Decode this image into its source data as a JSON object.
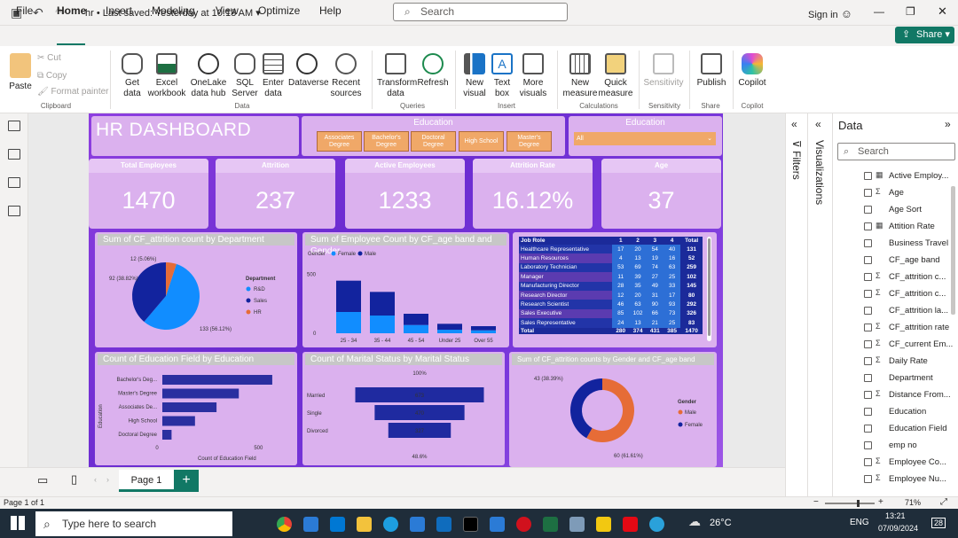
{
  "titlebar": {
    "doc_title": "hr • Last saved: Yesterday at 10:18 AM",
    "search_placeholder": "Search",
    "signin": "Sign in"
  },
  "menu": [
    "File",
    "Home",
    "Insert",
    "Modeling",
    "View",
    "Optimize",
    "Help"
  ],
  "share_label": "Share",
  "ribbon": {
    "paste": "Paste",
    "cut": "Cut",
    "copy": "Copy",
    "format_painter": "Format painter",
    "get_data": "Get data",
    "excel": "Excel workbook",
    "onelake": "OneLake data hub",
    "sql": "SQL Server",
    "enter": "Enter data",
    "dataverse": "Dataverse",
    "recent": "Recent sources",
    "transform": "Transform data",
    "refresh": "Refresh",
    "new_visual": "New visual",
    "text_box": "Text box",
    "more_visuals": "More visuals",
    "new_measure": "New measure",
    "quick_measure": "Quick measure",
    "sensitivity": "Sensitivity",
    "publish": "Publish",
    "copilot": "Copilot",
    "groups": {
      "clipboard": "Clipboard",
      "data": "Data",
      "queries": "Queries",
      "insert": "Insert",
      "calculations": "Calculations",
      "sensitivity": "Sensitivity",
      "share": "Share",
      "copilot": "Copilot"
    }
  },
  "dashboard": {
    "title": "HR DASHBOARD",
    "education_slicer": {
      "title": "Education",
      "options": [
        "Associates Degree",
        "Bachelor's Degree",
        "Doctoral Degree",
        "High School",
        "Master's Degree"
      ]
    },
    "education_dropdown": {
      "title": "Education",
      "value": "All"
    },
    "kpis": [
      {
        "label": "Total Employees",
        "value": "1470"
      },
      {
        "label": "Attrition",
        "value": "237"
      },
      {
        "label": "Active Employees",
        "value": "1233"
      },
      {
        "label": "Attrition Rate",
        "value": "16.12%"
      },
      {
        "label": "Age",
        "value": "37"
      }
    ]
  },
  "chart_data": [
    {
      "type": "pie",
      "title": "Sum of CF_attrition count by Department",
      "legend_title": "Department",
      "labels": [
        "R&D",
        "Sales",
        "HR"
      ],
      "values": [
        133,
        92,
        12
      ],
      "data_labels": [
        "133 (56.12%)",
        "92 (38.82%)",
        "12 (5.06%)"
      ],
      "colors": [
        "#118dff",
        "#12239e",
        "#e66c37"
      ]
    },
    {
      "type": "bar",
      "title": "Sum of Employee Count by CF_age band and Gender",
      "legend_title": "Gender",
      "series_names": [
        "Female",
        "Male"
      ],
      "categories": [
        "25 - 34",
        "35 - 44",
        "45 - 54",
        "Under 25",
        "Over 55"
      ],
      "series": [
        {
          "name": "Female",
          "values": [
            180,
            150,
            70,
            30,
            25
          ]
        },
        {
          "name": "Male",
          "values": [
            265,
            200,
            95,
            50,
            35
          ]
        }
      ],
      "ytick": "500",
      "ymax": 600,
      "colors": [
        "#118dff",
        "#12239e"
      ]
    },
    {
      "type": "table",
      "title": "",
      "columns": [
        "Job Role",
        "1",
        "2",
        "3",
        "4",
        "Total"
      ],
      "rows": [
        [
          "Healthcare Representative",
          "17",
          "20",
          "54",
          "40",
          "131"
        ],
        [
          "Human Resources",
          "4",
          "13",
          "19",
          "16",
          "52"
        ],
        [
          "Laboratory Technician",
          "53",
          "69",
          "74",
          "63",
          "259"
        ],
        [
          "Manager",
          "11",
          "39",
          "27",
          "25",
          "102"
        ],
        [
          "Manufacturing Director",
          "28",
          "35",
          "49",
          "33",
          "145"
        ],
        [
          "Research Director",
          "12",
          "20",
          "31",
          "17",
          "80"
        ],
        [
          "Research Scientist",
          "46",
          "63",
          "90",
          "93",
          "292"
        ],
        [
          "Sales Executive",
          "85",
          "102",
          "66",
          "73",
          "326"
        ],
        [
          "Sales Representative",
          "24",
          "13",
          "21",
          "25",
          "83"
        ]
      ],
      "total": [
        "Total",
        "280",
        "374",
        "431",
        "385",
        "1470"
      ]
    },
    {
      "type": "bar",
      "orientation": "horizontal",
      "title": "Count of Education Field by Education",
      "ylabel": "Education",
      "xlabel": "Count of Education Field",
      "categories": [
        "Bachelor's Deg...",
        "Master's Degree",
        "Associates De...",
        "High School",
        "Doctoral Degree"
      ],
      "values": [
        572,
        398,
        282,
        170,
        48
      ],
      "xticks": [
        "0",
        "500"
      ],
      "xmax": 600
    },
    {
      "type": "funnel",
      "title": "Count of Marital Status by Marital Status",
      "categories": [
        "Married",
        "Single",
        "Divorced"
      ],
      "values": [
        673,
        470,
        327
      ],
      "top_label": "100%",
      "bottom_label": "48.6%"
    },
    {
      "type": "donut",
      "title": "Sum of CF_attrition counts by Gender and CF_age band",
      "legend_title": "Gender",
      "labels": [
        "Male",
        "Female"
      ],
      "values": [
        60,
        43
      ],
      "data_labels": [
        "60 (61.61%)",
        "43 (38.39%)"
      ],
      "colors": [
        "#e66c37",
        "#12239e"
      ]
    }
  ],
  "panes": {
    "filters": "Filters",
    "visualizations": "Visualizations",
    "data_title": "Data",
    "data_search": "Search",
    "fields": [
      {
        "name": "Active Employ...",
        "kind": "calc"
      },
      {
        "name": "Age",
        "kind": "sum"
      },
      {
        "name": "Age Sort",
        "kind": ""
      },
      {
        "name": "Attition Rate",
        "kind": "calc"
      },
      {
        "name": "Business Travel",
        "kind": ""
      },
      {
        "name": "CF_age band",
        "kind": ""
      },
      {
        "name": "CF_attrition c...",
        "kind": "sum"
      },
      {
        "name": "CF_attrition c...",
        "kind": "sum"
      },
      {
        "name": "CF_attrition la...",
        "kind": ""
      },
      {
        "name": "CF_attrition rate",
        "kind": "sum"
      },
      {
        "name": "CF_current Em...",
        "kind": "sum"
      },
      {
        "name": "Daily Rate",
        "kind": "sum"
      },
      {
        "name": "Department",
        "kind": ""
      },
      {
        "name": "Distance From...",
        "kind": "sum"
      },
      {
        "name": "Education",
        "kind": ""
      },
      {
        "name": "Education Field",
        "kind": ""
      },
      {
        "name": "emp no",
        "kind": ""
      },
      {
        "name": "Employee Co...",
        "kind": "sum"
      },
      {
        "name": "Employee Nu...",
        "kind": "sum"
      }
    ]
  },
  "pages": {
    "tab": "Page 1",
    "status": "Page 1 of 1",
    "zoom": "71%"
  },
  "taskbar": {
    "search": "Type here to search",
    "weather": "26°C",
    "lang": "ENG",
    "time": "13:21",
    "date": "07/09/2024",
    "notif": "28"
  }
}
